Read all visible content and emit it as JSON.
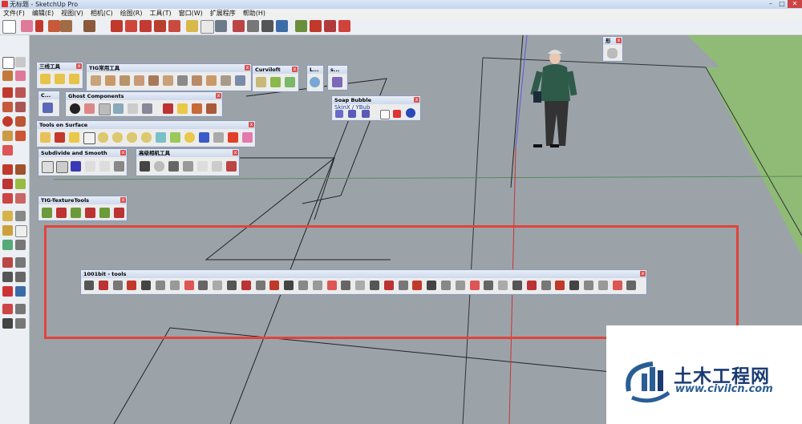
{
  "window": {
    "title": "无标题 - SketchUp Pro",
    "min": "–",
    "max": "□",
    "close": "✕"
  },
  "menu": [
    "文件(F)",
    "编辑(E)",
    "视图(V)",
    "相机(C)",
    "绘图(R)",
    "工具(T)",
    "窗口(W)",
    "扩展程序",
    "帮助(H)"
  ],
  "panels": {
    "sanxian": {
      "title": "三线工具"
    },
    "tig_common": {
      "title": "TIG常用工具"
    },
    "curviloft": {
      "title": "Curviloft"
    },
    "small_l": {
      "title": "L..."
    },
    "small_s": {
      "title": "s..."
    },
    "small_c": {
      "title": "C..."
    },
    "ghost": {
      "title": "Ghost Components"
    },
    "soap": {
      "title": "Soap Bubble",
      "label": "SkinX / YBub"
    },
    "tools_on_surface": {
      "title": "Tools on Surface"
    },
    "subdivide": {
      "title": "Subdivide and Smooth"
    },
    "camera": {
      "title": "高级相机工具"
    },
    "texture": {
      "title": "TIG-TextureTools"
    },
    "bit1001": {
      "title": "1001bit - tools"
    },
    "shape": {
      "title": "形"
    }
  },
  "watermark": {
    "name": "土木工程网",
    "url": "www.civilcn.com"
  },
  "colors": {
    "viewport": "#9ba3a9",
    "grass": "#8fbb76",
    "highlight": "#e2433c"
  }
}
